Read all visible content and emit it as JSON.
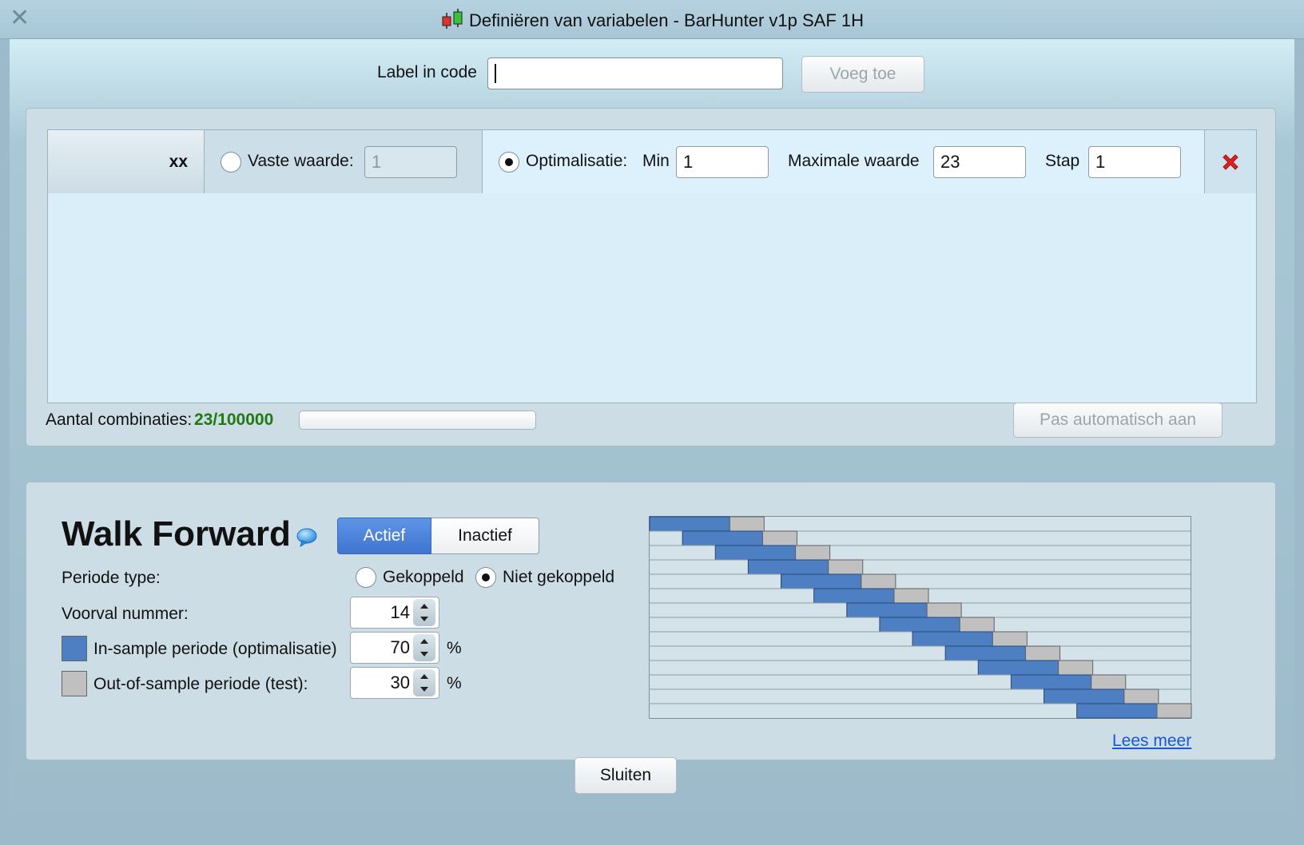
{
  "window": {
    "title": "Definiëren van variabelen - BarHunter v1p SAF 1H",
    "close_glyph": "✕",
    "icon": "candlestick-icon"
  },
  "label_entry": {
    "label": "Label in code",
    "value": "",
    "add_button": "Voeg toe"
  },
  "variable": {
    "name": "xx",
    "fixed_label": "Vaste waarde:",
    "fixed_value": "1",
    "fixed_selected": false,
    "opt_label": "Optimalisatie:",
    "opt_selected": true,
    "min_label": "Min",
    "min_value": "1",
    "max_label": "Maximale waarde",
    "max_value": "23",
    "step_label": "Stap",
    "step_value": "1",
    "delete_icon": "red-x-icon"
  },
  "combinations": {
    "label": "Aantal combinaties:",
    "value": "23/100000",
    "value_color": "#1f7a10",
    "progress_fraction": 0.00023,
    "auto_button": "Pas automatisch aan"
  },
  "walk_forward": {
    "title": "Walk Forward",
    "info_icon": "speech-bubble-icon",
    "active_label": "Actief",
    "inactive_label": "Inactief",
    "active_selected": true,
    "period_type_label": "Periode type:",
    "coupled_label": "Gekoppeld",
    "uncoupled_label": "Niet gekoppeld",
    "uncoupled_selected": true,
    "runs_label": "Voorval nummer:",
    "runs_value": "14",
    "in_sample_label": "In-sample periode (optimalisatie)",
    "in_sample_value": "70",
    "out_sample_label": "Out-of-sample periode (test):",
    "out_sample_value": "30",
    "percent": "%",
    "in_sample_color": "#4d7fc2",
    "out_sample_color": "#c0c0c0",
    "more_link": "Lees meer"
  },
  "close_button": "Sluiten"
}
